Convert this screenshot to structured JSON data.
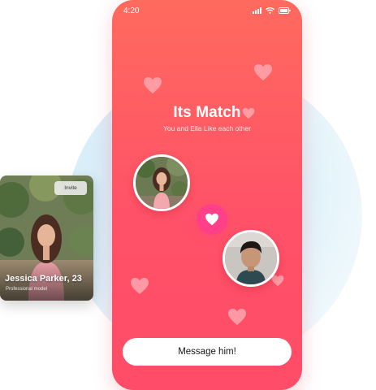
{
  "status_bar": {
    "time": "4:20"
  },
  "match_screen": {
    "title": "Its Match",
    "subtitle": "You and Ella Like each other",
    "cta_label": "Message him!"
  },
  "profile_card": {
    "invite_label": "Invite",
    "name": "Jessica Parker, 23",
    "occupation": "Professional model"
  },
  "colors": {
    "phone_gradient_top": "#ff6a5e",
    "phone_gradient_bottom": "#ff4c68",
    "heart_badge": "#ff3f88",
    "background_circle": "#dcf0fa"
  },
  "icons": [
    "signal-icon",
    "wifi-icon",
    "battery-icon",
    "heart-icon"
  ]
}
